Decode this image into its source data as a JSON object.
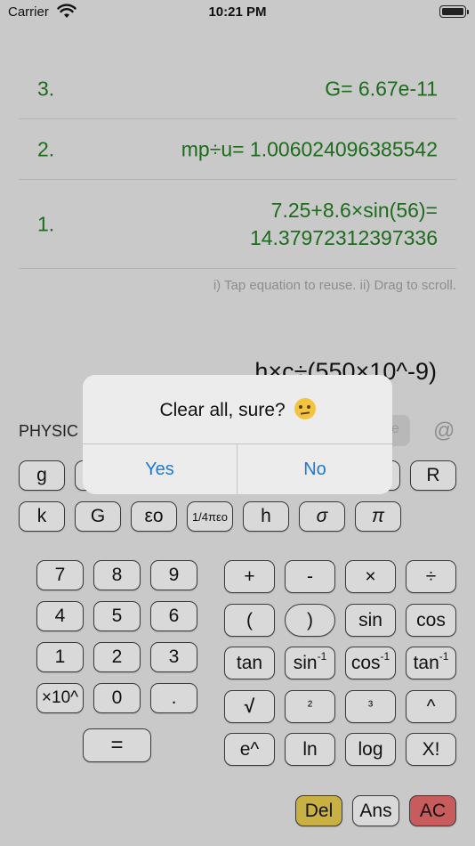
{
  "status_bar": {
    "carrier": "Carrier",
    "time": "10:21 PM"
  },
  "history": {
    "rows": [
      {
        "index": "3.",
        "equation": "G= 6.67e-11"
      },
      {
        "index": "2.",
        "equation": "mp÷u= 1.006024096385542"
      },
      {
        "index": "1.",
        "equation": "7.25+8.6×sin(56)=\n14.37972312397336"
      }
    ],
    "hint": "i) Tap equation to reuse. ii) Drag to scroll."
  },
  "current_input": "h×c÷(550×10^-9)",
  "mode_label": "PHYSIC",
  "at_symbol": "@",
  "constants_row1": [
    "g",
    "R"
  ],
  "constants_row2": [
    "k",
    "G",
    "εo",
    "1/4πεo",
    "h",
    "σ",
    "π"
  ],
  "numpad": {
    "row1": [
      "7",
      "8",
      "9"
    ],
    "row2": [
      "4",
      "5",
      "6"
    ],
    "row3": [
      "1",
      "2",
      "3"
    ],
    "row4": [
      "×10^",
      "0",
      "."
    ],
    "equals": "="
  },
  "functions": {
    "row1": [
      "+",
      "-",
      "×",
      "÷"
    ],
    "row2": [
      "(",
      ")",
      "sin",
      "cos"
    ],
    "row3_base": [
      "tan",
      "sin",
      "cos",
      "tan"
    ],
    "row3_sup": "-1",
    "row4": [
      "√",
      "²",
      "³",
      "^"
    ],
    "row5": [
      "e^",
      "ln",
      "log",
      "X!"
    ]
  },
  "bottom_keys": {
    "del": "Del",
    "ans": "Ans",
    "ac": "AC"
  },
  "alert": {
    "title": "Clear all, sure?",
    "yes": "Yes",
    "no": "No"
  },
  "colors": {
    "history_text": "#1d6b1d",
    "alert_button": "#1a7bd6",
    "del": "#c9b043",
    "ac": "#c85b5b"
  }
}
